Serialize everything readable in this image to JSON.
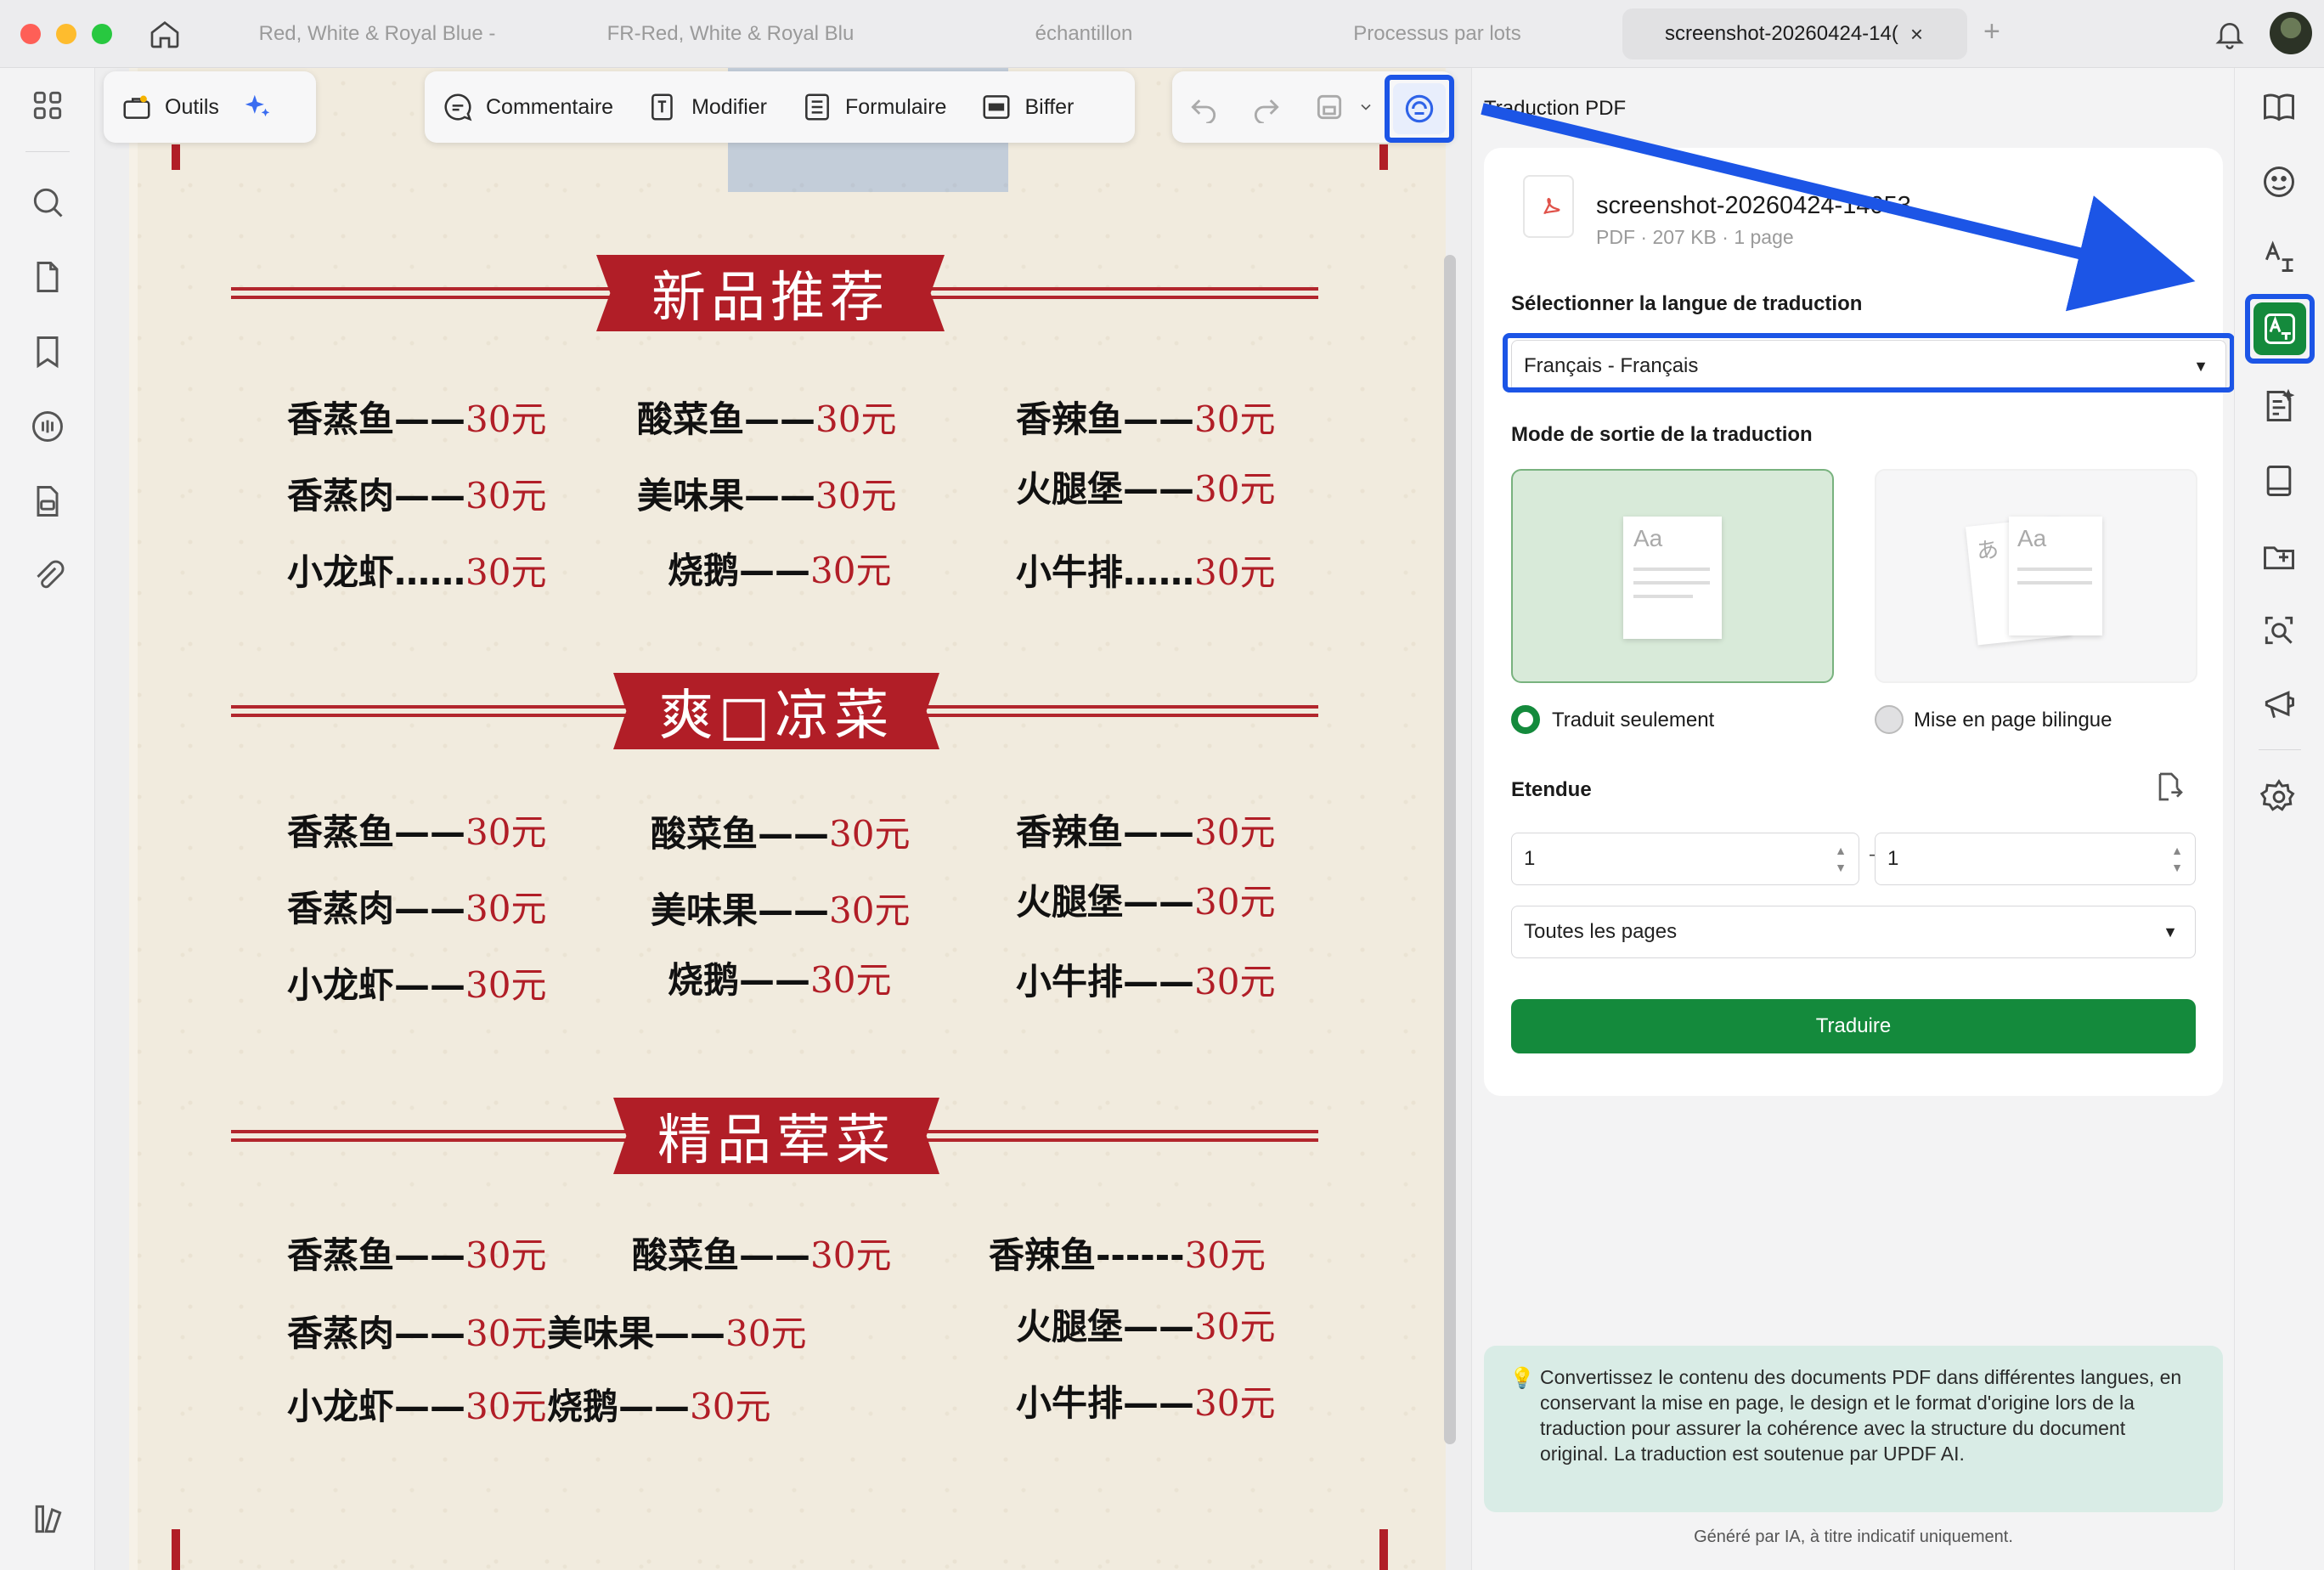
{
  "tabs": [
    {
      "label": "Red, White & Royal Blue -"
    },
    {
      "label": "FR-Red, White & Royal Blu"
    },
    {
      "label": "échantillon"
    },
    {
      "label": "Processus par lots"
    },
    {
      "label": "screenshot-20260424-14("
    }
  ],
  "tab_close": "×",
  "tab_add": "+",
  "toolbar": {
    "tools": "Outils",
    "comment": "Commentaire",
    "edit": "Modifier",
    "form": "Formulaire",
    "strike": "Biffer"
  },
  "menu": {
    "section1": "新品推荐",
    "section2": "爽□凉菜",
    "section3": "精品荤菜",
    "s1": [
      {
        "name": "香蒸鱼——",
        "price": "30元"
      },
      {
        "name": "酸菜鱼——",
        "price": "30元"
      },
      {
        "name": "香辣鱼——",
        "price": "30元"
      },
      {
        "name": "香蒸肉——",
        "price": "30元"
      },
      {
        "name": "美味果——",
        "price": "30元"
      },
      {
        "name": "火腿堡——",
        "price": "30元"
      },
      {
        "name": "小龙虾……",
        "price": "30元"
      },
      {
        "name": "烧鹅——",
        "price": "30元"
      },
      {
        "name": "小牛排……",
        "price": "30元"
      }
    ],
    "s2": [
      {
        "name": "香蒸鱼——",
        "price": "30元"
      },
      {
        "name": "酸菜鱼——",
        "price": "30元"
      },
      {
        "name": "香辣鱼——",
        "price": "30元"
      },
      {
        "name": "香蒸肉——",
        "price": "30元"
      },
      {
        "name": "美味果——",
        "price": "30元"
      },
      {
        "name": "火腿堡——",
        "price": "30元"
      },
      {
        "name": "小龙虾——",
        "price": "30元"
      },
      {
        "name": "烧鹅——",
        "price": "30元"
      },
      {
        "name": "小牛排——",
        "price": "30元"
      }
    ],
    "s3": [
      {
        "name": "香蒸鱼——",
        "price": "30元"
      },
      {
        "name": "酸菜鱼——",
        "price": "30元"
      },
      {
        "name": "香辣鱼------",
        "price": "30元"
      },
      {
        "name": "香蒸肉——",
        "price": "30元"
      },
      {
        "name": "美味果——",
        "price": "30元"
      },
      {
        "name": "火腿堡——",
        "price": "30元"
      },
      {
        "name": "小龙虾——",
        "price": "30元"
      },
      {
        "name": "烧鹅——",
        "price": "30元"
      },
      {
        "name": "小牛排——",
        "price": "30元"
      }
    ]
  },
  "panel": {
    "title": "Traduction PDF",
    "file_name": "screenshot-20260424-14053",
    "file_meta": "PDF · 207 KB · 1 page",
    "lang_label": "Sélectionner la langue de traduction",
    "lang_value": "Français - Français",
    "mode_label": "Mode de sortie de la traduction",
    "mode_translated": "Traduit seulement",
    "mode_bilingual": "Mise en page bilingue",
    "range_label": "Etendue",
    "range_from": "1",
    "range_sep": "–",
    "range_to": "1",
    "pages_value": "Toutes les pages",
    "translate_button": "Traduire",
    "info_text": "Convertissez le contenu des documents PDF dans différentes langues, en conservant la mise en page, le design et le format d'origine lors de la traduction pour assurer la cohérence avec la structure du document original. La traduction est soutenue par UPDF AI.",
    "footer_note": "Généré par IA, à titre indicatif uniquement.",
    "thumb_aa": "Aa",
    "thumb_a": "あ"
  },
  "colors": {
    "accent_blue": "#1c55e6",
    "accent_green": "#148a3c",
    "menu_red": "#b11e27"
  }
}
